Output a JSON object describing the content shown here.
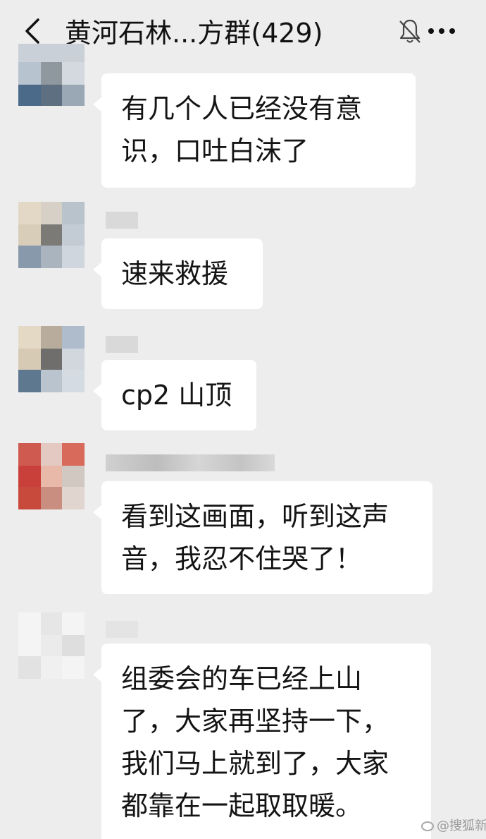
{
  "header": {
    "title": "黄河石林...方群(429)",
    "back_icon": "chevron-left-icon",
    "mute_icon": "bell-muted-icon",
    "more_icon": "more-dots-icon"
  },
  "messages": [
    {
      "lines": [
        "有几个人已经没有意",
        "识，口吐白沫了"
      ]
    },
    {
      "lines": [
        "速来救援"
      ]
    },
    {
      "lines": [
        "cp2 山顶"
      ]
    },
    {
      "lines": [
        "看到这画面，听到这声",
        "音，我忍不住哭了！"
      ]
    },
    {
      "lines": [
        "组委会的车已经上山",
        "了，大家再坚持一下，",
        "我们马上就到了，大家",
        "都靠在一起取取暖。"
      ]
    }
  ],
  "watermark": {
    "text": "@搜狐新闻",
    "icon": "weibo-icon"
  },
  "colors": {
    "background": "#ededed",
    "bubble": "#ffffff",
    "text": "#141414"
  }
}
